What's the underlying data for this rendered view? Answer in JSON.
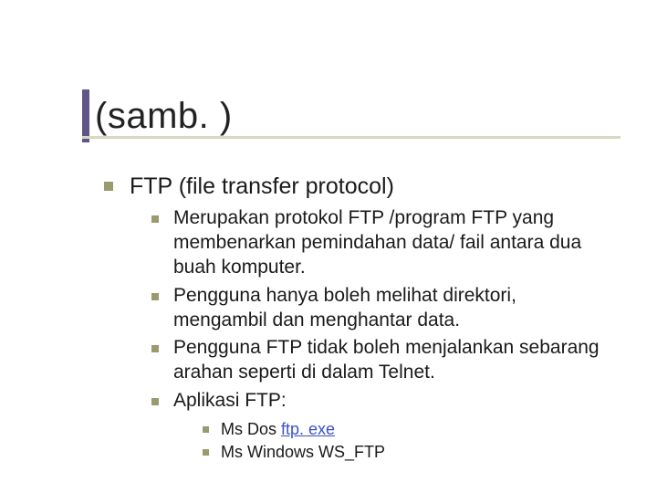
{
  "slide": {
    "title": "(samb. )",
    "topic": "FTP (file transfer protocol)",
    "points": [
      "Merupakan protokol FTP /program FTP yang membenarkan pemindahan data/ fail antara dua buah komputer.",
      "Pengguna hanya boleh melihat direktori, mengambil dan menghantar data.",
      "Pengguna FTP tidak boleh menjalankan sebarang arahan seperti di dalam Telnet.",
      "Aplikasi FTP:"
    ],
    "apps": {
      "msdos_prefix": "Ms Dos ",
      "msdos_link": "ftp. exe",
      "mswindows": "Ms Windows WS_FTP"
    }
  }
}
